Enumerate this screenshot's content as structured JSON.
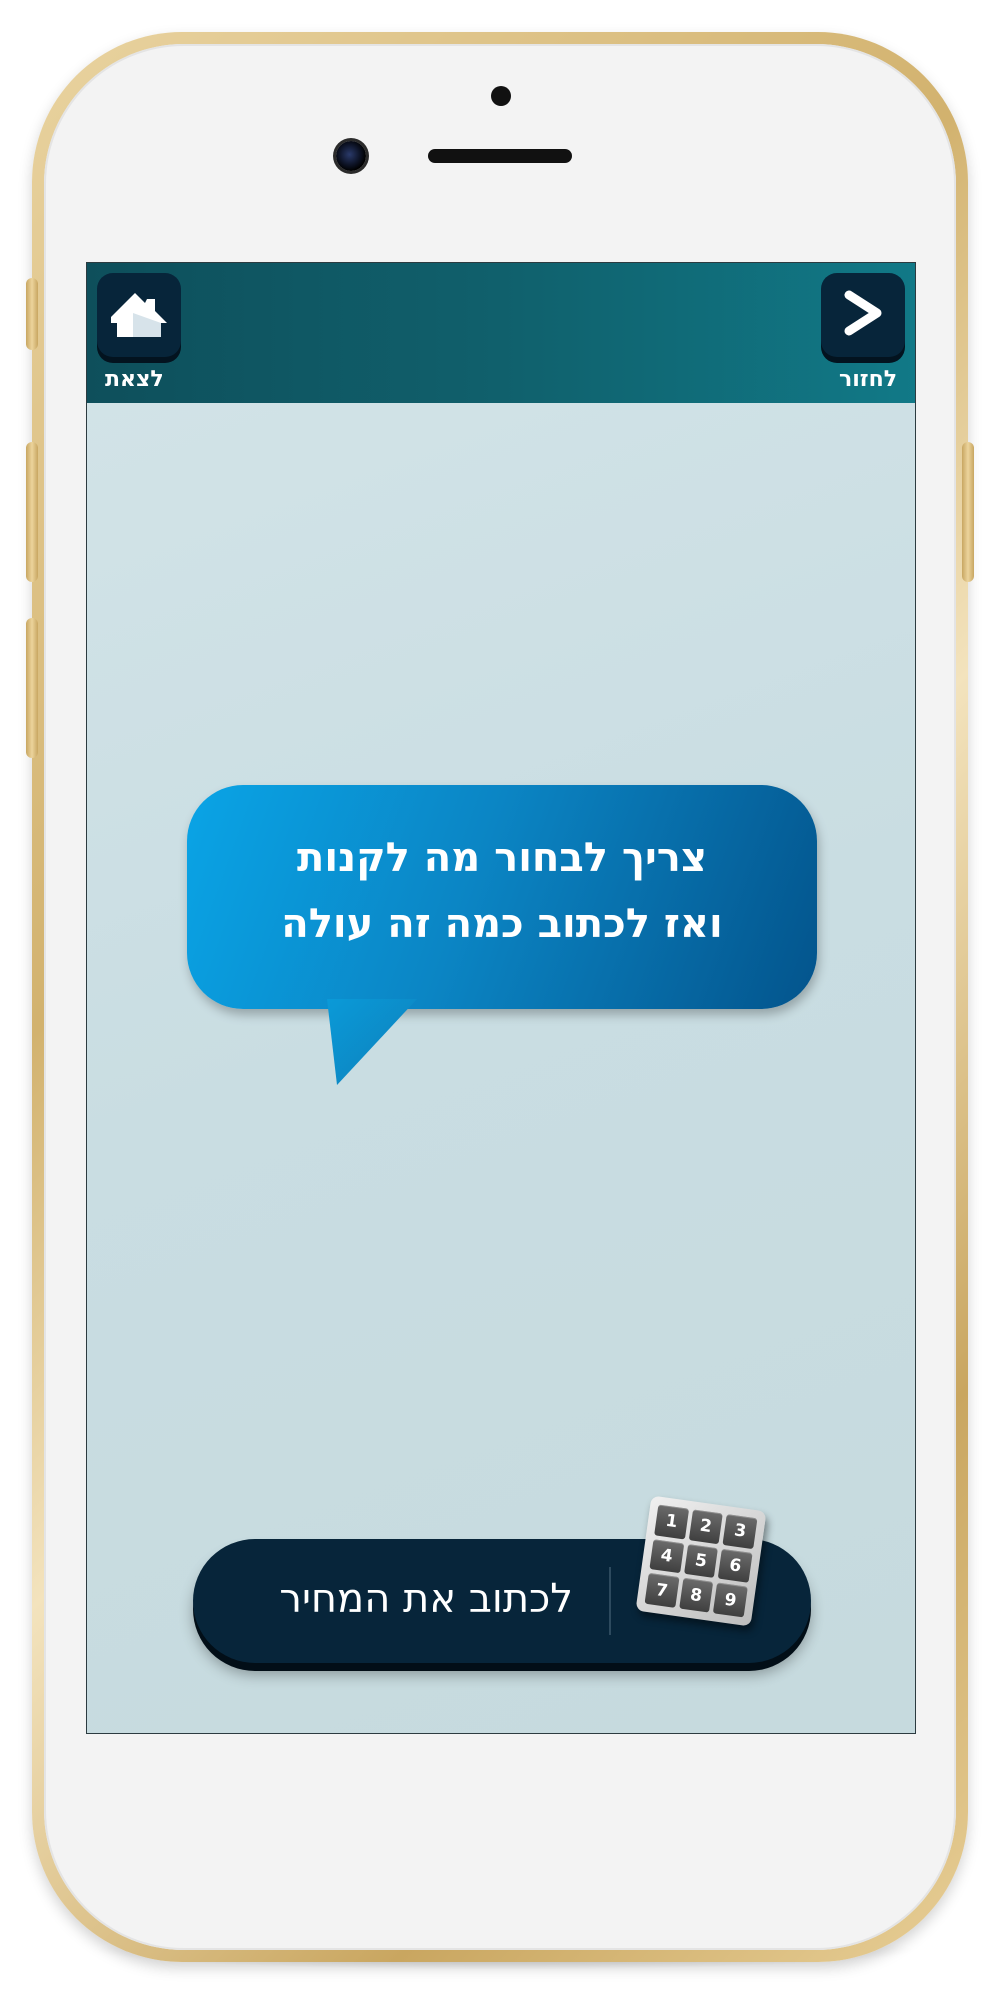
{
  "header": {
    "home_label": "לצאת",
    "back_label": "לחזור"
  },
  "icons": {
    "home": "home-icon",
    "back": "chevron-right-icon",
    "keypad": "number-keypad-icon"
  },
  "bubble": {
    "line1": "צריך לבחור מה לקנות",
    "line2": "ואז לכתוב כמה זה עולה"
  },
  "cta": {
    "label": "לכתוב את המחיר",
    "keypad_digits": [
      "1",
      "2",
      "3",
      "4",
      "5",
      "6",
      "7",
      "8",
      "9"
    ]
  },
  "colors": {
    "header": "#10606c",
    "button": "#07253a",
    "screen_bg": "#c9dde2",
    "bubble_light": "#0aa4e6",
    "bubble_dark": "#03548c",
    "frame_gold": "#d2b26e"
  }
}
